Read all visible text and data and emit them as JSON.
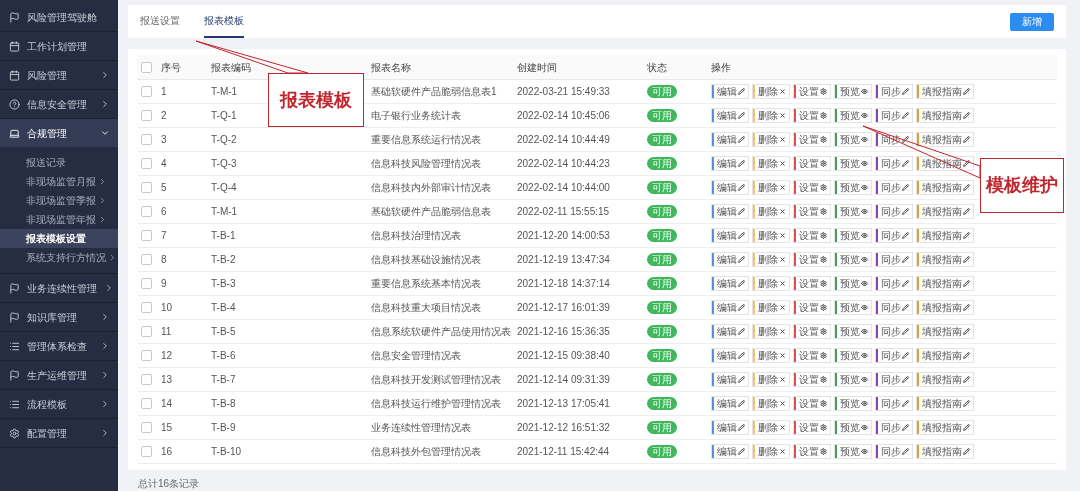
{
  "sidebar": {
    "items": [
      {
        "label": "风险管理驾驶舱",
        "kind": "link"
      },
      {
        "label": "工作计划管理",
        "kind": "link"
      },
      {
        "label": "风险管理",
        "kind": "group",
        "expanded": false
      },
      {
        "label": "信息安全管理",
        "kind": "group",
        "expanded": false
      },
      {
        "label": "合规管理",
        "kind": "group",
        "expanded": true,
        "children": [
          {
            "label": "报送记录",
            "kind": "link",
            "selected": false
          },
          {
            "label": "非现场监管月报",
            "kind": "group",
            "selected": false
          },
          {
            "label": "非现场监管季报",
            "kind": "group",
            "selected": false
          },
          {
            "label": "非现场监管年报",
            "kind": "group",
            "selected": false
          },
          {
            "label": "报表模板设置",
            "kind": "link",
            "selected": true
          },
          {
            "label": "系统支持行方情况",
            "kind": "group",
            "selected": false
          }
        ]
      },
      {
        "label": "业务连续性管理",
        "kind": "group",
        "expanded": false
      },
      {
        "label": "知识库管理",
        "kind": "group",
        "expanded": false
      },
      {
        "label": "管理体系检查",
        "kind": "group",
        "expanded": false
      },
      {
        "label": "生产运维管理",
        "kind": "group",
        "expanded": false
      },
      {
        "label": "流程模板",
        "kind": "group",
        "expanded": false
      },
      {
        "label": "配置管理",
        "kind": "group",
        "expanded": false
      }
    ]
  },
  "tabs": [
    {
      "label": "报送设置",
      "selected": false
    },
    {
      "label": "报表模板",
      "selected": true
    }
  ],
  "add_button": "新增",
  "table": {
    "select_all_checked": false,
    "columns": [
      "序号",
      "报表编码",
      "报表名称",
      "创建时间",
      "状态",
      "操作"
    ],
    "rows": [
      {
        "checked": false,
        "number": "1",
        "code": "T-M-1",
        "name": "基础软硬件产品脆弱信息表1",
        "created": "2022-03-21 15:49:33",
        "status": "可用",
        "actions": [
          {
            "kind": "edit",
            "label": "编辑",
            "color": "#5b8fd0"
          },
          {
            "kind": "delete",
            "label": "删除",
            "color": "#f0c36d"
          },
          {
            "kind": "settings",
            "label": "设置",
            "color": "#d9534f"
          },
          {
            "kind": "preview",
            "label": "预览",
            "color": "#4a9d5b"
          },
          {
            "kind": "sync",
            "label": "同步",
            "color": "#8e44ad"
          },
          {
            "kind": "guide",
            "label": "填报指南",
            "color": "#e0a030"
          }
        ]
      },
      {
        "checked": false,
        "number": "2",
        "code": "T-Q-1",
        "name": "电子银行业务统计表",
        "created": "2022-02-14 10:45:06",
        "status": "可用",
        "actions": [
          {
            "kind": "edit",
            "label": "编辑",
            "color": "#5b8fd0"
          },
          {
            "kind": "delete",
            "label": "删除",
            "color": "#f0c36d"
          },
          {
            "kind": "settings",
            "label": "设置",
            "color": "#d9534f"
          },
          {
            "kind": "preview",
            "label": "预览",
            "color": "#4a9d5b"
          },
          {
            "kind": "sync",
            "label": "同步",
            "color": "#8e44ad"
          },
          {
            "kind": "guide",
            "label": "填报指南",
            "color": "#e0a030"
          }
        ]
      },
      {
        "checked": false,
        "number": "3",
        "code": "T-Q-2",
        "name": "重要信息系统运行情况表",
        "created": "2022-02-14 10:44:49",
        "status": "可用",
        "actions": [
          {
            "kind": "edit",
            "label": "编辑",
            "color": "#5b8fd0"
          },
          {
            "kind": "delete",
            "label": "删除",
            "color": "#f0c36d"
          },
          {
            "kind": "settings",
            "label": "设置",
            "color": "#d9534f"
          },
          {
            "kind": "preview",
            "label": "预览",
            "color": "#4a9d5b"
          },
          {
            "kind": "sync",
            "label": "同步",
            "color": "#8e44ad"
          },
          {
            "kind": "guide",
            "label": "填报指南",
            "color": "#e0a030"
          }
        ]
      },
      {
        "checked": false,
        "number": "4",
        "code": "T-Q-3",
        "name": "信息科技风险管理情况表",
        "created": "2022-02-14 10:44:23",
        "status": "可用",
        "actions": [
          {
            "kind": "edit",
            "label": "编辑",
            "color": "#5b8fd0"
          },
          {
            "kind": "delete",
            "label": "删除",
            "color": "#f0c36d"
          },
          {
            "kind": "settings",
            "label": "设置",
            "color": "#d9534f"
          },
          {
            "kind": "preview",
            "label": "预览",
            "color": "#4a9d5b"
          },
          {
            "kind": "sync",
            "label": "同步",
            "color": "#8e44ad"
          },
          {
            "kind": "guide",
            "label": "填报指南",
            "color": "#e0a030"
          }
        ]
      },
      {
        "checked": false,
        "number": "5",
        "code": "T-Q-4",
        "name": "信息科技内外部审计情况表",
        "created": "2022-02-14 10:44:00",
        "status": "可用",
        "actions": [
          {
            "kind": "edit",
            "label": "编辑",
            "color": "#5b8fd0"
          },
          {
            "kind": "delete",
            "label": "删除",
            "color": "#f0c36d"
          },
          {
            "kind": "settings",
            "label": "设置",
            "color": "#d9534f"
          },
          {
            "kind": "preview",
            "label": "预览",
            "color": "#4a9d5b"
          },
          {
            "kind": "sync",
            "label": "同步",
            "color": "#8e44ad"
          },
          {
            "kind": "guide",
            "label": "填报指南",
            "color": "#e0a030"
          }
        ]
      },
      {
        "checked": false,
        "number": "6",
        "code": "T-M-1",
        "name": "基础软硬件产品脆弱信息表",
        "created": "2022-02-11 15:55:15",
        "status": "可用",
        "actions": [
          {
            "kind": "edit",
            "label": "编辑",
            "color": "#5b8fd0"
          },
          {
            "kind": "delete",
            "label": "删除",
            "color": "#f0c36d"
          },
          {
            "kind": "settings",
            "label": "设置",
            "color": "#d9534f"
          },
          {
            "kind": "preview",
            "label": "预览",
            "color": "#4a9d5b"
          },
          {
            "kind": "sync",
            "label": "同步",
            "color": "#8e44ad"
          },
          {
            "kind": "guide",
            "label": "填报指南",
            "color": "#e0a030"
          }
        ]
      },
      {
        "checked": false,
        "number": "7",
        "code": "T-B-1",
        "name": "信息科技治理情况表",
        "created": "2021-12-20 14:00:53",
        "status": "可用",
        "actions": [
          {
            "kind": "edit",
            "label": "编辑",
            "color": "#5b8fd0"
          },
          {
            "kind": "delete",
            "label": "删除",
            "color": "#f0c36d"
          },
          {
            "kind": "settings",
            "label": "设置",
            "color": "#d9534f"
          },
          {
            "kind": "preview",
            "label": "预览",
            "color": "#4a9d5b"
          },
          {
            "kind": "sync",
            "label": "同步",
            "color": "#8e44ad"
          },
          {
            "kind": "guide",
            "label": "填报指南",
            "color": "#e0a030"
          }
        ]
      },
      {
        "checked": false,
        "number": "8",
        "code": "T-B-2",
        "name": "信息科技基础设施情况表",
        "created": "2021-12-19 13:47:34",
        "status": "可用",
        "actions": [
          {
            "kind": "edit",
            "label": "编辑",
            "color": "#5b8fd0"
          },
          {
            "kind": "delete",
            "label": "删除",
            "color": "#f0c36d"
          },
          {
            "kind": "settings",
            "label": "设置",
            "color": "#d9534f"
          },
          {
            "kind": "preview",
            "label": "预览",
            "color": "#4a9d5b"
          },
          {
            "kind": "sync",
            "label": "同步",
            "color": "#8e44ad"
          },
          {
            "kind": "guide",
            "label": "填报指南",
            "color": "#e0a030"
          }
        ]
      },
      {
        "checked": false,
        "number": "9",
        "code": "T-B-3",
        "name": "重要信息系统基本情况表",
        "created": "2021-12-18 14:37:14",
        "status": "可用",
        "actions": [
          {
            "kind": "edit",
            "label": "编辑",
            "color": "#5b8fd0"
          },
          {
            "kind": "delete",
            "label": "删除",
            "color": "#f0c36d"
          },
          {
            "kind": "settings",
            "label": "设置",
            "color": "#d9534f"
          },
          {
            "kind": "preview",
            "label": "预览",
            "color": "#4a9d5b"
          },
          {
            "kind": "sync",
            "label": "同步",
            "color": "#8e44ad"
          },
          {
            "kind": "guide",
            "label": "填报指南",
            "color": "#e0a030"
          }
        ]
      },
      {
        "checked": false,
        "number": "10",
        "code": "T-B-4",
        "name": "信息科技重大项目情况表",
        "created": "2021-12-17 16:01:39",
        "status": "可用",
        "actions": [
          {
            "kind": "edit",
            "label": "编辑",
            "color": "#5b8fd0"
          },
          {
            "kind": "delete",
            "label": "删除",
            "color": "#f0c36d"
          },
          {
            "kind": "settings",
            "label": "设置",
            "color": "#d9534f"
          },
          {
            "kind": "preview",
            "label": "预览",
            "color": "#4a9d5b"
          },
          {
            "kind": "sync",
            "label": "同步",
            "color": "#8e44ad"
          },
          {
            "kind": "guide",
            "label": "填报指南",
            "color": "#e0a030"
          }
        ]
      },
      {
        "checked": false,
        "number": "11",
        "code": "T-B-5",
        "name": "信息系统软硬件产品使用情况表",
        "created": "2021-12-16 15:36:35",
        "status": "可用",
        "actions": [
          {
            "kind": "edit",
            "label": "编辑",
            "color": "#5b8fd0"
          },
          {
            "kind": "delete",
            "label": "删除",
            "color": "#f0c36d"
          },
          {
            "kind": "settings",
            "label": "设置",
            "color": "#d9534f"
          },
          {
            "kind": "preview",
            "label": "预览",
            "color": "#4a9d5b"
          },
          {
            "kind": "sync",
            "label": "同步",
            "color": "#8e44ad"
          },
          {
            "kind": "guide",
            "label": "填报指南",
            "color": "#e0a030"
          }
        ]
      },
      {
        "checked": false,
        "number": "12",
        "code": "T-B-6",
        "name": "信息安全管理情况表",
        "created": "2021-12-15 09:38:40",
        "status": "可用",
        "actions": [
          {
            "kind": "edit",
            "label": "编辑",
            "color": "#5b8fd0"
          },
          {
            "kind": "delete",
            "label": "删除",
            "color": "#f0c36d"
          },
          {
            "kind": "settings",
            "label": "设置",
            "color": "#d9534f"
          },
          {
            "kind": "preview",
            "label": "预览",
            "color": "#4a9d5b"
          },
          {
            "kind": "sync",
            "label": "同步",
            "color": "#8e44ad"
          },
          {
            "kind": "guide",
            "label": "填报指南",
            "color": "#e0a030"
          }
        ]
      },
      {
        "checked": false,
        "number": "13",
        "code": "T-B-7",
        "name": "信息科技开发测试管理情况表",
        "created": "2021-12-14 09:31:39",
        "status": "可用",
        "actions": [
          {
            "kind": "edit",
            "label": "编辑",
            "color": "#5b8fd0"
          },
          {
            "kind": "delete",
            "label": "删除",
            "color": "#f0c36d"
          },
          {
            "kind": "settings",
            "label": "设置",
            "color": "#d9534f"
          },
          {
            "kind": "preview",
            "label": "预览",
            "color": "#4a9d5b"
          },
          {
            "kind": "sync",
            "label": "同步",
            "color": "#8e44ad"
          },
          {
            "kind": "guide",
            "label": "填报指南",
            "color": "#e0a030"
          }
        ]
      },
      {
        "checked": false,
        "number": "14",
        "code": "T-B-8",
        "name": "信息科技运行维护管理情况表",
        "created": "2021-12-13 17:05:41",
        "status": "可用",
        "actions": [
          {
            "kind": "edit",
            "label": "编辑",
            "color": "#5b8fd0"
          },
          {
            "kind": "delete",
            "label": "删除",
            "color": "#f0c36d"
          },
          {
            "kind": "settings",
            "label": "设置",
            "color": "#d9534f"
          },
          {
            "kind": "preview",
            "label": "预览",
            "color": "#4a9d5b"
          },
          {
            "kind": "sync",
            "label": "同步",
            "color": "#8e44ad"
          },
          {
            "kind": "guide",
            "label": "填报指南",
            "color": "#e0a030"
          }
        ]
      },
      {
        "checked": false,
        "number": "15",
        "code": "T-B-9",
        "name": "业务连续性管理情况表",
        "created": "2021-12-12 16:51:32",
        "status": "可用",
        "actions": [
          {
            "kind": "edit",
            "label": "编辑",
            "color": "#5b8fd0"
          },
          {
            "kind": "delete",
            "label": "删除",
            "color": "#f0c36d"
          },
          {
            "kind": "settings",
            "label": "设置",
            "color": "#d9534f"
          },
          {
            "kind": "preview",
            "label": "预览",
            "color": "#4a9d5b"
          },
          {
            "kind": "sync",
            "label": "同步",
            "color": "#8e44ad"
          },
          {
            "kind": "guide",
            "label": "填报指南",
            "color": "#e0a030"
          }
        ]
      },
      {
        "checked": false,
        "number": "16",
        "code": "T-B-10",
        "name": "信息科技外包管理情况表",
        "created": "2021-12-11 15:42:44",
        "status": "可用",
        "actions": [
          {
            "kind": "edit",
            "label": "编辑",
            "color": "#5b8fd0"
          },
          {
            "kind": "delete",
            "label": "删除",
            "color": "#f0c36d"
          },
          {
            "kind": "settings",
            "label": "设置",
            "color": "#d9534f"
          },
          {
            "kind": "preview",
            "label": "预览",
            "color": "#4a9d5b"
          },
          {
            "kind": "sync",
            "label": "同步",
            "color": "#8e44ad"
          },
          {
            "kind": "guide",
            "label": "填报指南",
            "color": "#e0a030"
          }
        ]
      }
    ]
  },
  "footer": "总计16条记录",
  "annotations": [
    {
      "text": "报表模板"
    },
    {
      "text": "模板维护"
    }
  ]
}
